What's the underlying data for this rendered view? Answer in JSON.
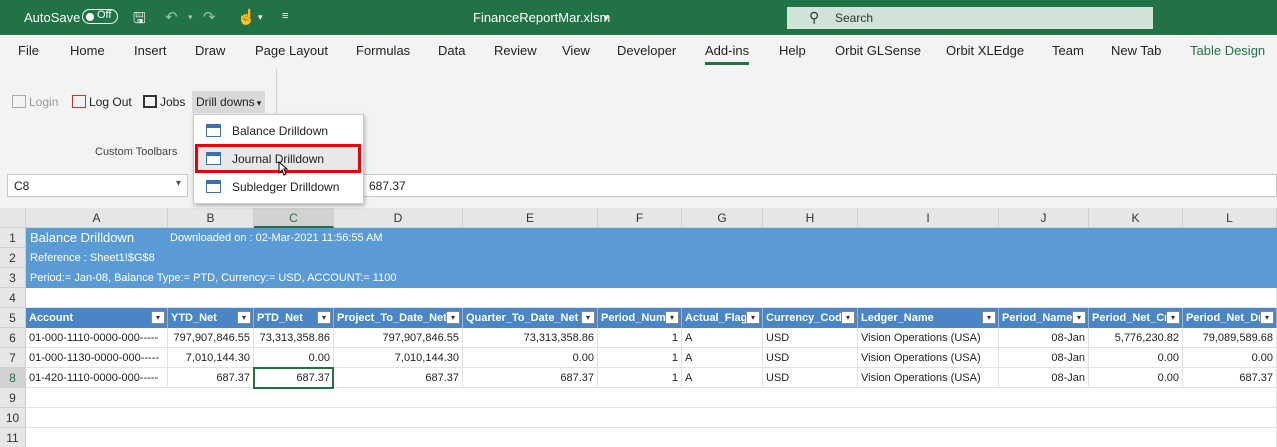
{
  "titlebar": {
    "autosave_label": "AutoSave",
    "autosave_state": "Off",
    "filename": "FinanceReportMar.xlsm",
    "search_placeholder": "Search"
  },
  "menu": {
    "tabs": [
      "File",
      "Home",
      "Insert",
      "Draw",
      "Page Layout",
      "Formulas",
      "Data",
      "Review",
      "View",
      "Developer",
      "Add-ins",
      "Help",
      "Orbit GLSense",
      "Orbit XLEdge",
      "Team",
      "New Tab",
      "Table Design"
    ],
    "active": "Add-ins"
  },
  "ribbon": {
    "login": "Login",
    "logout": "Log Out",
    "jobs": "Jobs",
    "drilldowns": "Drill downs",
    "group_label": "Custom Toolbars"
  },
  "dropdown": {
    "items": [
      "Balance Drilldown",
      "Journal Drilldown",
      "Subledger Drilldown"
    ],
    "highlighted": "Journal Drilldown"
  },
  "formula_bar": {
    "name_box": "C8",
    "formula": "687.37"
  },
  "sheet": {
    "columns": [
      "A",
      "B",
      "C",
      "D",
      "E",
      "F",
      "G",
      "H",
      "I",
      "J",
      "K",
      "L"
    ],
    "selected_column": "C",
    "rows": [
      "1",
      "2",
      "3",
      "4",
      "5",
      "6",
      "7",
      "8",
      "9",
      "10",
      "11"
    ],
    "selected_row": "8",
    "banner": {
      "title": "Balance Drilldown",
      "downloaded": "Downloaded on : 02-Mar-2021 11:56:55 AM",
      "reference": "Reference : Sheet1!$G$8",
      "params": "Period:= Jan-08, Balance Type:= PTD, Currency:= USD, ACCOUNT:= 1100"
    },
    "headers": [
      "Account",
      "YTD_Net",
      "PTD_Net",
      "Project_To_Date_Net",
      "Quarter_To_Date_Net",
      "Period_Num",
      "Actual_Flag",
      "Currency_Code",
      "Ledger_Name",
      "Period_Name",
      "Period_Net_Cr",
      "Period_Net_Dr"
    ],
    "data": [
      [
        "01-000-1110-0000-000-----",
        "797,907,846.55",
        "73,313,358.86",
        "797,907,846.55",
        "73,313,358.86",
        "1",
        "A",
        "USD",
        "Vision Operations (USA)",
        "08-Jan",
        "5,776,230.82",
        "79,089,589.68"
      ],
      [
        "01-000-1130-0000-000-----",
        "7,010,144.30",
        "0.00",
        "7,010,144.30",
        "0.00",
        "1",
        "A",
        "USD",
        "Vision Operations (USA)",
        "08-Jan",
        "0.00",
        "0.00"
      ],
      [
        "01-420-1110-0000-000-----",
        "687.37",
        "687.37",
        "687.37",
        "687.37",
        "1",
        "A",
        "USD",
        "Vision Operations (USA)",
        "08-Jan",
        "0.00",
        "687.37"
      ]
    ]
  },
  "colors": {
    "excel_green": "#217346",
    "banner_blue": "#5b9bd5",
    "header_blue": "#4a86c5",
    "highlight_red": "#ee0000"
  }
}
